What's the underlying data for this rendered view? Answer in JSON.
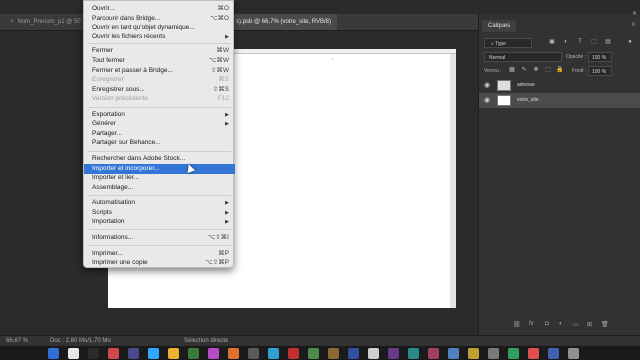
{
  "tabs": [
    {
      "label": "Nom_Prenom_p1 @ 50"
    },
    {
      "label": "s).psb @ 66,7% (votre_site, RVB/8)"
    }
  ],
  "menu": {
    "items": [
      {
        "label": "Ouvrir...",
        "shortcut": "⌘O"
      },
      {
        "label": "Parcourir dans Bridge...",
        "shortcut": "⌥⌘O"
      },
      {
        "label": "Ouvrir en tant qu'objet dynamique..."
      },
      {
        "label": "Ouvrir les fichiers récents",
        "submenu": true
      },
      {
        "label": "Fermer",
        "shortcut": "⌘W"
      },
      {
        "label": "Tout fermer",
        "shortcut": "⌥⌘W"
      },
      {
        "label": "Fermer et passer à Bridge...",
        "shortcut": "⇧⌘W"
      },
      {
        "label": "Enregistrer",
        "shortcut": "⌘S",
        "disabled": true
      },
      {
        "label": "Enregistrer sous...",
        "shortcut": "⇧⌘S"
      },
      {
        "label": "Version précédente",
        "shortcut": "F12",
        "disabled": true
      },
      {
        "label": "Exportation",
        "submenu": true
      },
      {
        "label": "Générer",
        "submenu": true
      },
      {
        "label": "Partager..."
      },
      {
        "label": "Partager sur Behance..."
      },
      {
        "label": "Rechercher dans Adobe Stock..."
      },
      {
        "label": "Importer et incorporer...",
        "highlighted": true
      },
      {
        "label": "Importer et lier..."
      },
      {
        "label": "Assemblage..."
      },
      {
        "label": "Automatisation",
        "submenu": true
      },
      {
        "label": "Scripts",
        "submenu": true
      },
      {
        "label": "Importation",
        "submenu": true
      },
      {
        "label": "Informations...",
        "shortcut": "⌥⇧⌘I"
      },
      {
        "label": "Imprimer...",
        "shortcut": "⌘P"
      },
      {
        "label": "Imprimer une copie",
        "shortcut": "⌥⇧⌘P"
      }
    ]
  },
  "layers_panel": {
    "tab_label": "Calques",
    "filter_label": "Type",
    "blend_mode": "Normal",
    "opacity_label": "Opacité :",
    "opacity_value": "100 %",
    "lock_label": "Verrou :",
    "fill_label": "Fond :",
    "fill_value": "100 %",
    "layers": [
      {
        "name": "adresse",
        "selected": false
      },
      {
        "name": "votre_site",
        "selected": true
      }
    ]
  },
  "status": {
    "zoom": "66,67 %",
    "doc_info": "Doc : 2,80 Mo/1,70 Mo",
    "tool_hint": "Sélection directe"
  },
  "dock_colors": [
    "#2f6fd6",
    "#e8e8e8",
    "#2a2a2a",
    "#d04a4a",
    "#4a4a8a",
    "#31a8ff",
    "#f0b030",
    "#3a7a3a",
    "#b44cc4",
    "#e07030",
    "#5a5a5a",
    "#2fa0d0",
    "#c03030",
    "#4c8c4c",
    "#8a6a30",
    "#3050a0",
    "#d0d0d0",
    "#6a3a8a",
    "#2a8a8a",
    "#a04060",
    "#5080c0",
    "#c0a030",
    "#7a7a7a",
    "#30a060",
    "#e05050",
    "#4060b0",
    "#909090"
  ]
}
